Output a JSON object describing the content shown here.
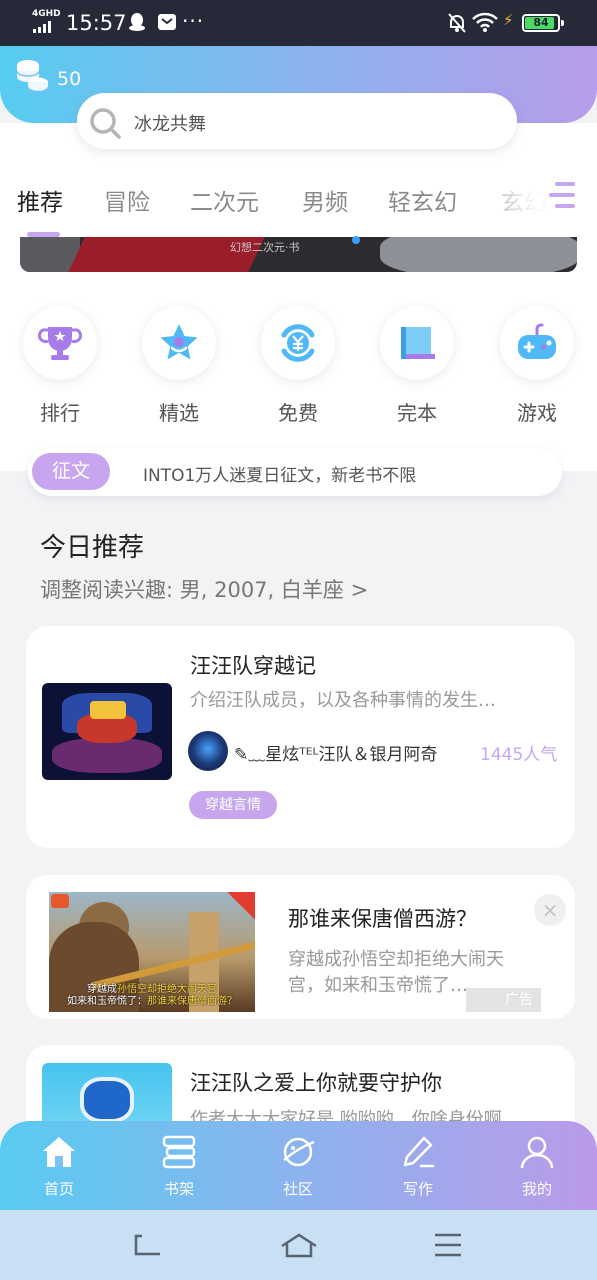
{
  "status_bar": {
    "network": "4GHD",
    "time": "15:57",
    "more": "···",
    "battery": "84",
    "icons": [
      "signal-icon",
      "qq-icon",
      "mail-icon",
      "mute-bell-icon",
      "wifi-icon",
      "charging-icon",
      "battery-icon"
    ]
  },
  "header": {
    "coins": "50",
    "search_placeholder": "冰龙共舞"
  },
  "tabs": [
    "推荐",
    "冒险",
    "二次元",
    "男频",
    "轻玄幻",
    "玄幻"
  ],
  "banner": {
    "caption": "幻想二次元·书"
  },
  "quick_entries": [
    {
      "label": "排行",
      "icon": "trophy-icon"
    },
    {
      "label": "精选",
      "icon": "star-icon"
    },
    {
      "label": "免费",
      "icon": "free-yen-icon"
    },
    {
      "label": "完本",
      "icon": "book-icon"
    },
    {
      "label": "游戏",
      "icon": "gamepad-icon"
    }
  ],
  "notice": {
    "tag": "征文",
    "text": "INTO1万人迷夏日征文，新老书不限"
  },
  "section": {
    "title": "今日推荐",
    "subtitle": "调整阅读兴趣: 男, 2007, 白羊座 >"
  },
  "book1": {
    "title": "汪汪队穿越记",
    "description": "介绍汪队成员，以及各种事情的发生…",
    "author": "✎﹏星炫ᵀᴱᴸ汪队＆银月阿奇",
    "popularity": "1445人气",
    "tag": "穿越言情"
  },
  "ad": {
    "title": "那谁来保唐僧西游？",
    "description": "穿越成孙悟空却拒绝大闹天宫，如来和玉帝慌了…",
    "label": "广告",
    "close": "×",
    "subtitle_line1_a": "穿越成",
    "subtitle_line1_b": "孙悟空却拒绝大闹天宫",
    "subtitle_line2_a": "如来和玉帝慌了：",
    "subtitle_line2_b": "那谁来保唐僧西游？"
  },
  "book2": {
    "title": "汪汪队之爱上你就要守护你",
    "description": "作者大大大家好是 哟哟哟，你啥身份啊…"
  },
  "bottom_nav": [
    {
      "label": "首页",
      "icon": "home-icon"
    },
    {
      "label": "书架",
      "icon": "bookshelf-icon"
    },
    {
      "label": "社区",
      "icon": "planet-icon"
    },
    {
      "label": "写作",
      "icon": "pen-icon"
    },
    {
      "label": "我的",
      "icon": "user-icon"
    }
  ],
  "colors": {
    "accent_purple": "#c7a6ee",
    "header_gradient_start": "#57ccf0",
    "header_gradient_end": "#b79cea",
    "icon_blue": "#4fb8f7",
    "icon_purple": "#a77ce8"
  }
}
